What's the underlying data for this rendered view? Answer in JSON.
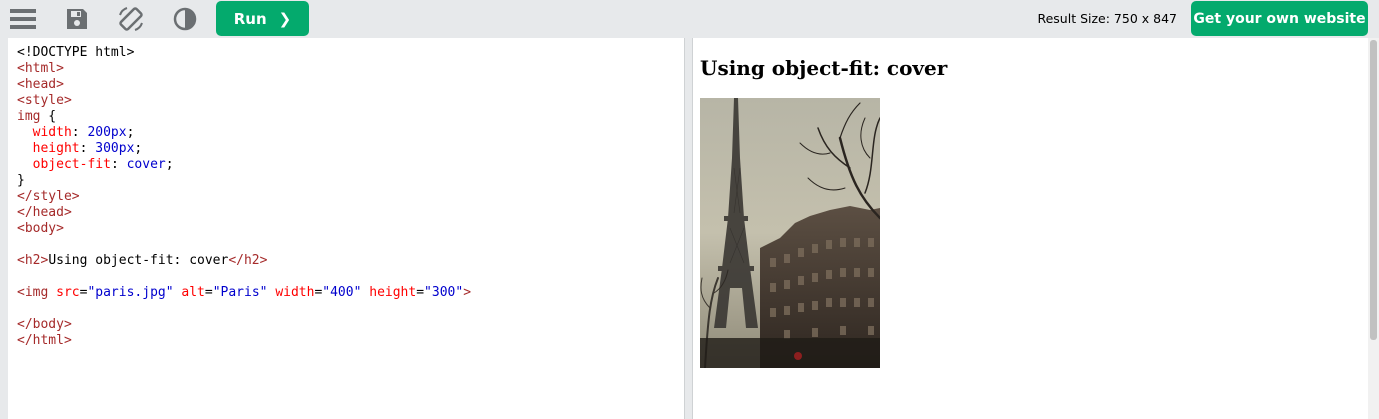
{
  "toolbar": {
    "icons": [
      "menu-icon",
      "save-icon",
      "rotate-icon",
      "contrast-icon"
    ],
    "run_label": "Run",
    "run_chevron": "❯",
    "result_size": "Result Size: 750 x 847",
    "get_site_label": "Get your own website"
  },
  "code": {
    "lines": [
      "<!DOCTYPE html>",
      "<html>",
      "<head>",
      "<style>",
      "img {",
      "  width: 200px;",
      "  height: 300px;",
      "  object-fit: cover;",
      "}",
      "</style>",
      "</head>",
      "<body>",
      "",
      "<h2>Using object-fit: cover</h2>",
      "",
      "<img src=\"paris.jpg\" alt=\"Paris\" width=\"400\" height=\"300\">",
      "",
      "</body>",
      "</html>"
    ]
  },
  "result": {
    "heading": "Using object-fit: cover",
    "image_alt": "Paris"
  },
  "colors": {
    "accent_green": "#04aa6d",
    "toolbar_bg": "#e7e9eb",
    "tag_color": "#a52a2a",
    "property_color": "#ff0000",
    "value_color": "#0000cd"
  }
}
